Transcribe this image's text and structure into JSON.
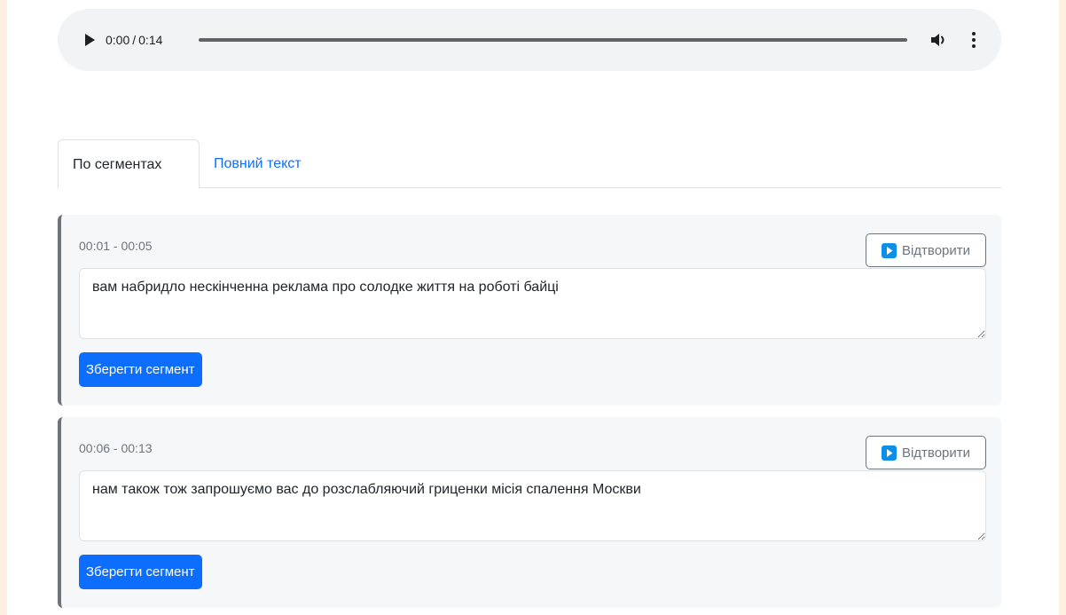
{
  "audio": {
    "current_time": "0:00",
    "separator": "/",
    "duration": "0:14",
    "progress_fraction": 0.0,
    "play_icon": "play-icon",
    "volume_icon": "volume-icon",
    "more_icon": "more-vertical-icon"
  },
  "tabs": [
    {
      "label": "По сегментах",
      "active": true
    },
    {
      "label": "Повний текст",
      "active": false
    }
  ],
  "segments": [
    {
      "time_range": "00:01 - 00:05",
      "play_label": "Відтворити",
      "text": "вам набридло нескінченна реклама про солодке життя на роботі байці",
      "save_label": "Зберегти сегмент"
    },
    {
      "time_range": "00:06 - 00:13",
      "play_label": "Відтворити",
      "text": "нам також тож запрошуємо вас до розслабляючий гриценки місія спалення Москви",
      "save_label": "Зберегти сегмент"
    }
  ],
  "colors": {
    "accent": "#0d6efd",
    "segment_border": "#6c757d",
    "page_background": "#fdf0e1"
  }
}
